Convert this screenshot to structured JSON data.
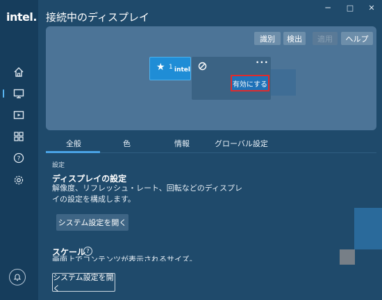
{
  "app": {
    "logo": "intel."
  },
  "header": {
    "title": "接続中のディスプレイ"
  },
  "window_controls": {
    "minimize": "−",
    "maximize": "□",
    "close": "✕"
  },
  "panel": {
    "buttons": {
      "identify": "識別",
      "detect": "検出",
      "apply": "適用",
      "help": "ヘルプ"
    },
    "display1": {
      "star": "★",
      "number": "1",
      "brand": "intel"
    },
    "display2": {
      "more": "•••",
      "enable": "有効にする"
    }
  },
  "tabs": [
    {
      "label": "全般"
    },
    {
      "label": "色"
    },
    {
      "label": "情報"
    },
    {
      "label": "グローバル設定"
    }
  ],
  "content": {
    "section": "設定",
    "display_settings": {
      "heading": "ディスプレイの設定",
      "desc_line1": "解像度、リフレッシュ・レート、回転などのディスプレ",
      "desc_line2": "イの設定を構成します。",
      "button": "システム設定を開く"
    },
    "scale": {
      "heading": "スケール",
      "help": "?",
      "desc": "画面上でコンテンツが表示されるサイズ。",
      "button": "システム設定を開く"
    }
  }
}
